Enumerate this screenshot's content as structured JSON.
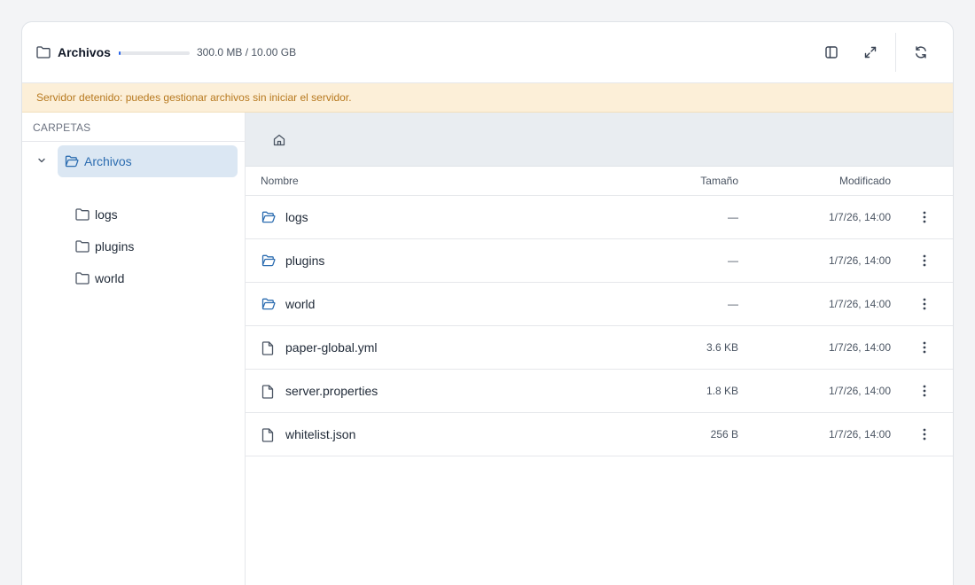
{
  "header": {
    "title": "Archivos",
    "usage_text": "300.0 MB / 10.00 GB",
    "usage_fraction": 0.03,
    "buttons": [
      "sidebar-toggle-icon",
      "expand-icon",
      "refresh-icon"
    ]
  },
  "banner": {
    "text": "Servidor detenido: puedes gestionar archivos sin iniciar el servidor."
  },
  "sidebar": {
    "heading": "CARPETAS",
    "root": "Archivos",
    "folders": [
      "logs",
      "plugins",
      "world"
    ]
  },
  "table": {
    "columns": {
      "name": "Nombre",
      "size": "Tamaño",
      "modified": "Modificado"
    },
    "rows": [
      {
        "name": "logs",
        "type": "folder",
        "size": "—",
        "modified": "1/7/26, 14:00"
      },
      {
        "name": "plugins",
        "type": "folder",
        "size": "—",
        "modified": "1/7/26, 14:00"
      },
      {
        "name": "world",
        "type": "folder",
        "size": "—",
        "modified": "1/7/26, 14:00"
      },
      {
        "name": "paper-global.yml",
        "type": "file",
        "size": "3.6 KB",
        "modified": "1/7/26, 14:00"
      },
      {
        "name": "server.properties",
        "type": "file",
        "size": "1.8 KB",
        "modified": "1/7/26, 14:00"
      },
      {
        "name": "whitelist.json",
        "type": "file",
        "size": "256 B",
        "modified": "1/7/26, 14:00"
      }
    ]
  },
  "colors": {
    "accent": "#2b6cb0",
    "selected_bg": "#dbe7f3",
    "banner_bg": "#fcefd8",
    "banner_text": "#b7791f"
  }
}
